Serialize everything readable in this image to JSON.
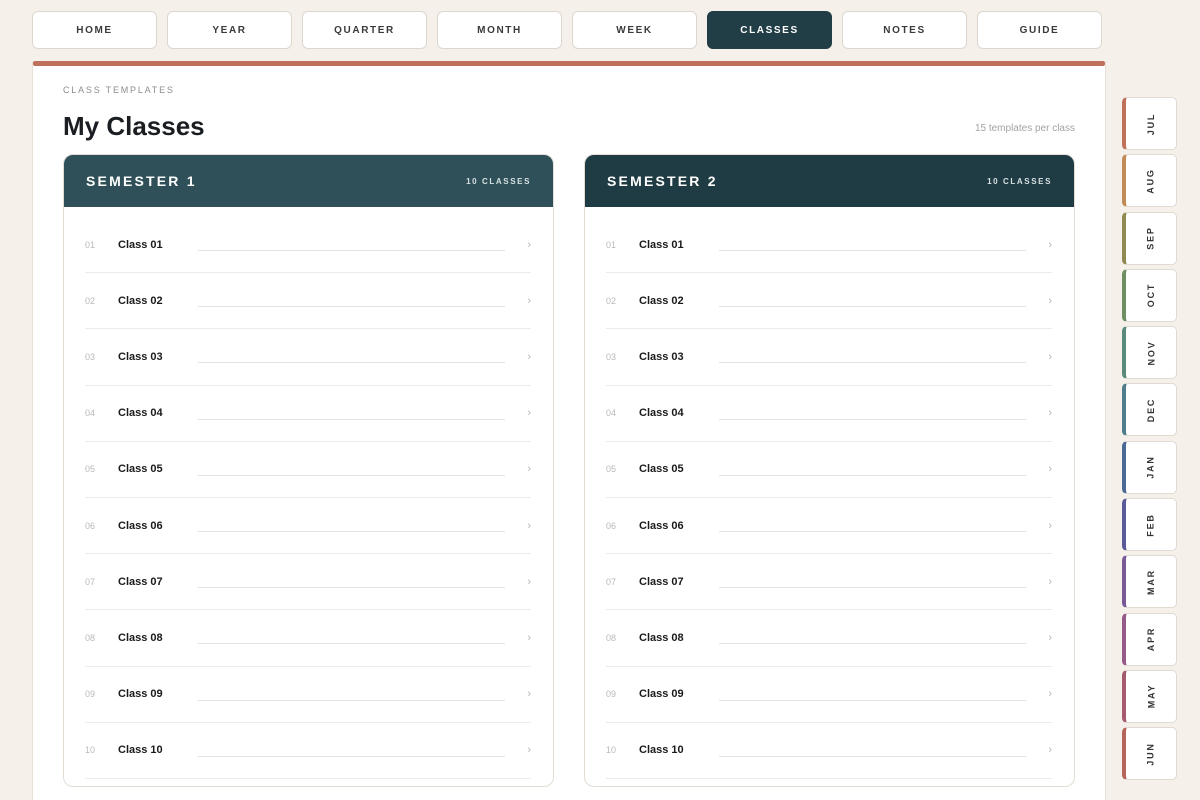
{
  "nav": {
    "tabs": [
      {
        "label": "HOME"
      },
      {
        "label": "YEAR"
      },
      {
        "label": "QUARTER"
      },
      {
        "label": "MONTH"
      },
      {
        "label": "WEEK"
      },
      {
        "label": "CLASSES"
      },
      {
        "label": "NOTES"
      },
      {
        "label": "GUIDE"
      }
    ],
    "active": "CLASSES",
    "active_color": "#213d45"
  },
  "page": {
    "eyebrow": "CLASS TEMPLATES",
    "title": "My Classes",
    "meta": "15 templates per class",
    "accent_color": "#c0715b"
  },
  "semesters": [
    {
      "title": "SEMESTER 1",
      "count": "10 CLASSES",
      "header_color": "#2f5059",
      "classes": [
        {
          "num": "01",
          "name": "Class 01"
        },
        {
          "num": "02",
          "name": "Class 02"
        },
        {
          "num": "03",
          "name": "Class 03"
        },
        {
          "num": "04",
          "name": "Class 04"
        },
        {
          "num": "05",
          "name": "Class 05"
        },
        {
          "num": "06",
          "name": "Class 06"
        },
        {
          "num": "07",
          "name": "Class 07"
        },
        {
          "num": "08",
          "name": "Class 08"
        },
        {
          "num": "09",
          "name": "Class 09"
        },
        {
          "num": "10",
          "name": "Class 10"
        }
      ]
    },
    {
      "title": "SEMESTER 2",
      "count": "10 CLASSES",
      "header_color": "#1f3b43",
      "classes": [
        {
          "num": "01",
          "name": "Class 01"
        },
        {
          "num": "02",
          "name": "Class 02"
        },
        {
          "num": "03",
          "name": "Class 03"
        },
        {
          "num": "04",
          "name": "Class 04"
        },
        {
          "num": "05",
          "name": "Class 05"
        },
        {
          "num": "06",
          "name": "Class 06"
        },
        {
          "num": "07",
          "name": "Class 07"
        },
        {
          "num": "08",
          "name": "Class 08"
        },
        {
          "num": "09",
          "name": "Class 09"
        },
        {
          "num": "10",
          "name": "Class 10"
        }
      ]
    }
  ],
  "row_icon": "chevron-right-icon",
  "months": [
    {
      "label": "JUL",
      "color": "#c0715b"
    },
    {
      "label": "AUG",
      "color": "#c28a55"
    },
    {
      "label": "SEP",
      "color": "#8e8a52"
    },
    {
      "label": "OCT",
      "color": "#6f8f63"
    },
    {
      "label": "NOV",
      "color": "#5a8a7a"
    },
    {
      "label": "DEC",
      "color": "#4f7d8c"
    },
    {
      "label": "JAN",
      "color": "#4a6a95"
    },
    {
      "label": "FEB",
      "color": "#5a5a9a"
    },
    {
      "label": "MAR",
      "color": "#7a5a96"
    },
    {
      "label": "APR",
      "color": "#965a88"
    },
    {
      "label": "MAY",
      "color": "#a55a6e"
    },
    {
      "label": "JUN",
      "color": "#b5645a"
    }
  ]
}
